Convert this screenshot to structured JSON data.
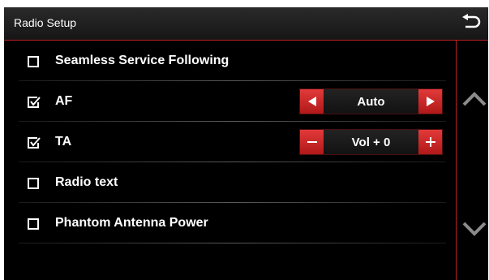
{
  "header": {
    "title": "Radio Setup",
    "back_icon": "back-arrow-icon"
  },
  "settings": [
    {
      "label": "Seamless Service Following",
      "checked": false
    },
    {
      "label": "AF",
      "checked": true,
      "control": {
        "type": "select",
        "value": "Auto",
        "decrease_icon": "triangle-left-icon",
        "increase_icon": "triangle-right-icon"
      }
    },
    {
      "label": "TA",
      "checked": true,
      "control": {
        "type": "stepper",
        "value": "Vol + 0",
        "decrease_icon": "minus-icon",
        "increase_icon": "plus-icon"
      }
    },
    {
      "label": "Radio text",
      "checked": false
    },
    {
      "label": "Phantom Antenna Power",
      "checked": false
    }
  ],
  "scroll": {
    "up_icon": "chevron-up-icon",
    "down_icon": "chevron-down-icon"
  },
  "colors": {
    "accent": "#c92222",
    "background": "#000000",
    "text": "#ffffff",
    "icon_gray": "#8c8c8c"
  }
}
